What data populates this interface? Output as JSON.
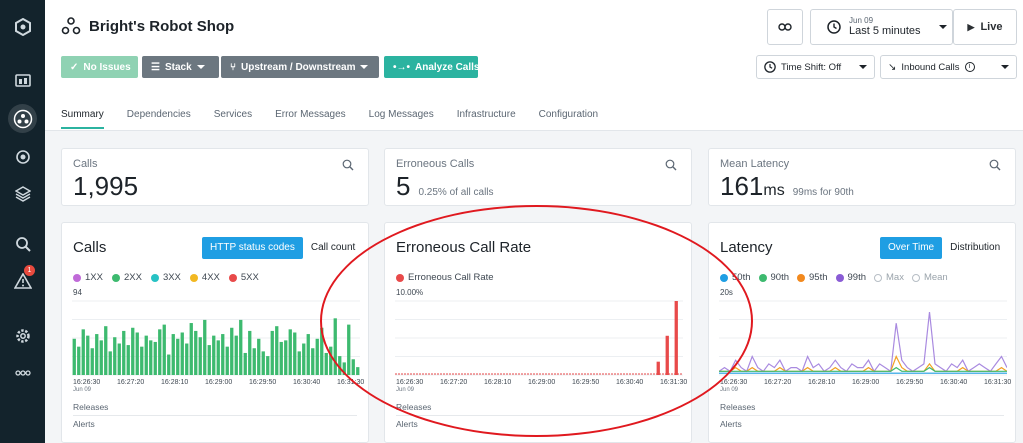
{
  "header": {
    "title": "Bright's Robot Shop",
    "buttons": {
      "no_issues": "No Issues",
      "stack": "Stack",
      "upstream": "Upstream / Downstream",
      "analyze": "Analyze Calls"
    },
    "time": {
      "date": "Jun 09",
      "range": "Last 5 minutes",
      "live": "Live"
    },
    "time_shift": "Time Shift: Off",
    "inbound": "Inbound Calls"
  },
  "tabs": [
    "Summary",
    "Dependencies",
    "Services",
    "Error Messages",
    "Log Messages",
    "Infrastructure",
    "Configuration"
  ],
  "kpis": {
    "calls": {
      "label": "Calls",
      "value": "1,995"
    },
    "errors": {
      "label": "Erroneous Calls",
      "value": "5",
      "sub": "0.25% of all calls"
    },
    "latency": {
      "label": "Mean Latency",
      "value": "161",
      "unit": "ms",
      "sub": "99ms for 90th"
    }
  },
  "calls_chart": {
    "title": "Calls",
    "toggle_on": "HTTP status codes",
    "toggle_off": "Call count",
    "legend": [
      "1XX",
      "2XX",
      "3XX",
      "4XX",
      "5XX"
    ],
    "ymax": "94"
  },
  "error_chart": {
    "title": "Erroneous Call Rate",
    "legend": "Erroneous Call Rate",
    "ymax": "10.00%"
  },
  "latency_chart": {
    "title": "Latency",
    "toggle_on": "Over Time",
    "toggle_off": "Distribution",
    "legend": [
      "50th",
      "90th",
      "95th",
      "99th",
      "Max",
      "Mean"
    ],
    "ymax": "20s"
  },
  "xticks": [
    "16:26:30",
    "16:27:20",
    "16:28:10",
    "16:29:00",
    "16:29:50",
    "16:30:40",
    "16:31:30"
  ],
  "xtick_sub": "Jun 09",
  "releases": "Releases",
  "alerts": "Alerts",
  "colors": {
    "green": "#3dba6f",
    "purple": "#a05cd5",
    "teal": "#27c2c4",
    "orange": "#f2a122",
    "red": "#e84a4a",
    "blue": "#1f9ee3",
    "badge": "#e84a3e"
  },
  "chart_data": [
    {
      "type": "bar",
      "title": "Calls",
      "series": [
        {
          "name": "2XX",
          "values": [
            46,
            36,
            58,
            50,
            34,
            52,
            44,
            62,
            30,
            48,
            40,
            56,
            38,
            60,
            54,
            36,
            50,
            44,
            42,
            58,
            64,
            26,
            52,
            46,
            54,
            40,
            66,
            56,
            48,
            70,
            38,
            50,
            44,
            52,
            36,
            60,
            50,
            70,
            28,
            56,
            34,
            46,
            30,
            24,
            56,
            62,
            42,
            44,
            58,
            54,
            30,
            40,
            52,
            34,
            46,
            60,
            28,
            36,
            72,
            24,
            16,
            64,
            20,
            10
          ]
        }
      ],
      "ylim": [
        0,
        94
      ]
    },
    {
      "type": "bar",
      "title": "Erroneous Call Rate",
      "series": [
        {
          "name": "Erroneous Call Rate",
          "values": [
            0,
            0,
            0,
            0,
            0,
            0,
            0,
            0,
            0,
            0,
            0,
            0,
            0,
            0,
            0,
            0,
            0,
            0,
            0,
            0,
            0,
            0,
            0,
            0,
            0,
            0,
            0,
            0,
            0,
            0,
            0,
            0,
            0,
            0,
            0,
            0,
            0,
            0,
            0,
            0,
            0,
            0,
            0,
            0,
            0,
            0,
            0,
            0,
            0,
            0,
            0,
            0,
            0,
            0,
            0,
            0,
            0,
            0,
            1.8,
            0,
            5.3,
            0,
            10,
            0
          ]
        }
      ],
      "ylim": [
        0,
        10
      ]
    },
    {
      "type": "line",
      "title": "Latency",
      "series": [
        {
          "name": "99th",
          "values": [
            1,
            2,
            1,
            4,
            2,
            1,
            5,
            2,
            1,
            3,
            2,
            4,
            1,
            2,
            2,
            1,
            5,
            2,
            3,
            1,
            2,
            4,
            2,
            1,
            3,
            2,
            2,
            4,
            1,
            3,
            2,
            1,
            14,
            4,
            2,
            1,
            2,
            3,
            17,
            3,
            2,
            1,
            3,
            2,
            4,
            1,
            2,
            3,
            2,
            1,
            3,
            5,
            2
          ]
        },
        {
          "name": "95th",
          "values": [
            1,
            1,
            1,
            2,
            1,
            1,
            2,
            1,
            1,
            1,
            1,
            2,
            1,
            1,
            1,
            1,
            2,
            1,
            1,
            1,
            1,
            2,
            1,
            1,
            1,
            1,
            1,
            2,
            1,
            1,
            1,
            1,
            5,
            2,
            1,
            1,
            1,
            1,
            3,
            1,
            1,
            1,
            1,
            1,
            2,
            1,
            1,
            1,
            1,
            1,
            1,
            2,
            1
          ]
        },
        {
          "name": "90th",
          "values": [
            1,
            1,
            1,
            1,
            1,
            1,
            1,
            1,
            1,
            1,
            1,
            1,
            1,
            1,
            1,
            1,
            1,
            1,
            1,
            1,
            1,
            1,
            1,
            1,
            1,
            1,
            1,
            1,
            1,
            1,
            1,
            1,
            2,
            1,
            1,
            1,
            1,
            1,
            2,
            1,
            1,
            1,
            1,
            1,
            1,
            1,
            1,
            1,
            1,
            1,
            1,
            1,
            1
          ]
        },
        {
          "name": "50th",
          "values": [
            0.5,
            0.5,
            0.5,
            0.5,
            0.5,
            0.5,
            0.5,
            0.5,
            0.5,
            0.5,
            0.5,
            0.5,
            0.5,
            0.5,
            0.5,
            0.5,
            0.5,
            0.5,
            0.5,
            0.5,
            0.5,
            0.5,
            0.5,
            0.5,
            0.5,
            0.5,
            0.5,
            0.5,
            0.5,
            0.5,
            0.5,
            0.5,
            0.5,
            0.5,
            0.5,
            0.5,
            0.5,
            0.5,
            0.5,
            0.5,
            0.5,
            0.5,
            0.5,
            0.5,
            0.5,
            0.5,
            0.5,
            0.5,
            0.5,
            0.5,
            0.5,
            0.5,
            0.5
          ]
        }
      ],
      "ylim": [
        0,
        20
      ]
    }
  ]
}
